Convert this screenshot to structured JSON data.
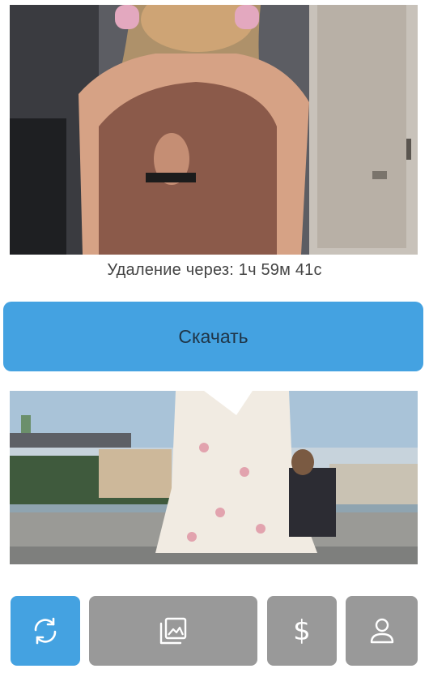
{
  "feed": {
    "items": [
      {
        "image_alt": "Девушка в коричневом топе и розовых наушниках",
        "timer_label": "Удаление через:",
        "timer_value": "1ч 59м 41с",
        "download_label": "Скачать"
      },
      {
        "image_alt": "Девушка в платье с цветочным принтом на набережной"
      }
    ]
  },
  "bottom_nav": {
    "items": [
      {
        "icon": "refresh-icon",
        "active": true
      },
      {
        "icon": "gallery-icon",
        "active": false
      },
      {
        "icon": "dollar-icon",
        "glyph": "$",
        "active": false
      },
      {
        "icon": "user-icon",
        "active": false
      }
    ]
  },
  "colors": {
    "accent": "#44a2e1",
    "nav_inactive": "#999999",
    "timer_text": "#444444"
  }
}
